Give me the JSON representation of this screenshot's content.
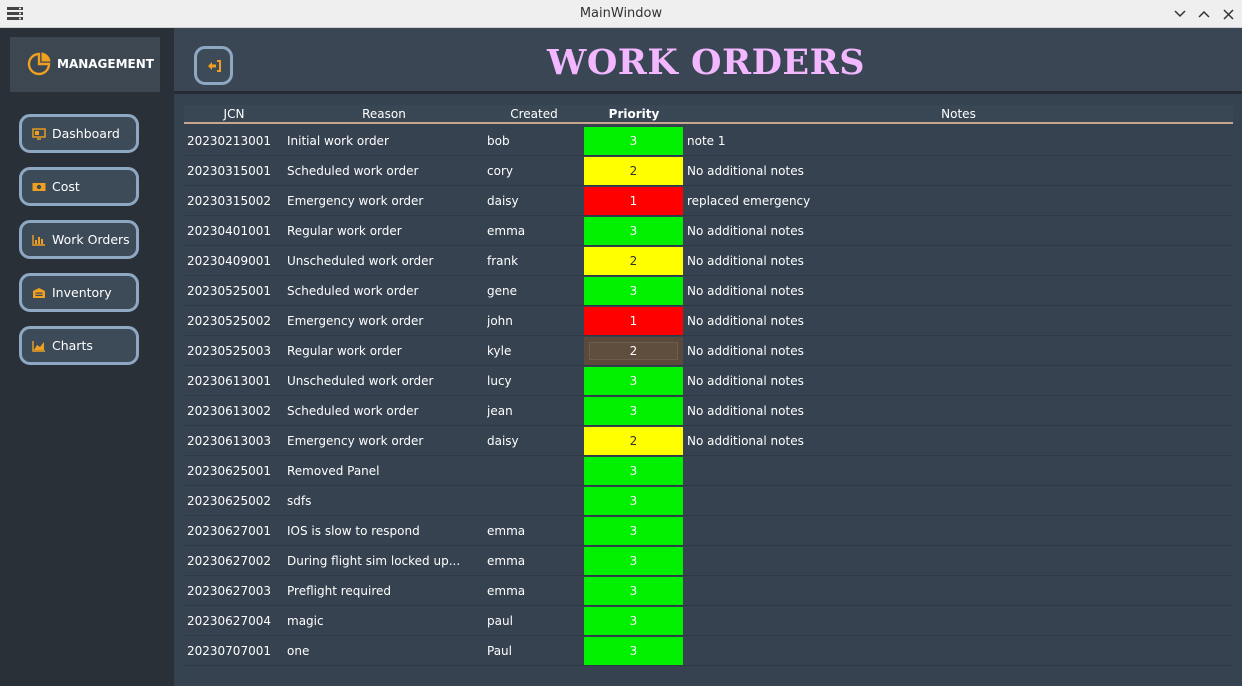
{
  "window": {
    "title": "MainWindow"
  },
  "sidebar": {
    "brand": "MANAGEMENT",
    "items": [
      {
        "label": "Dashboard",
        "icon": "monitor-icon"
      },
      {
        "label": "Cost",
        "icon": "cash-icon"
      },
      {
        "label": "Work Orders",
        "icon": "bar-chart-icon"
      },
      {
        "label": "Inventory",
        "icon": "warehouse-icon"
      },
      {
        "label": "Charts",
        "icon": "area-chart-icon"
      }
    ]
  },
  "header": {
    "title": "WORK ORDERS",
    "back_icon": "sign-out-arrow-icon"
  },
  "table": {
    "columns": [
      "JCN",
      "Reason",
      "Created",
      "Priority",
      "Notes"
    ],
    "rows": [
      {
        "jcn": "20230213001",
        "reason": "Initial work order",
        "created": "bob",
        "priority": "3",
        "notes": "note 1"
      },
      {
        "jcn": "20230315001",
        "reason": "Scheduled work order",
        "created": "cory",
        "priority": "2",
        "notes": "No additional notes"
      },
      {
        "jcn": "20230315002",
        "reason": "Emergency work order",
        "created": "daisy",
        "priority": "1",
        "notes": "replaced emergency"
      },
      {
        "jcn": "20230401001",
        "reason": "Regular work order",
        "created": "emma",
        "priority": "3",
        "notes": "No additional notes"
      },
      {
        "jcn": "20230409001",
        "reason": "Unscheduled work order",
        "created": "frank",
        "priority": "2",
        "notes": "No additional notes"
      },
      {
        "jcn": "20230525001",
        "reason": "Scheduled work order",
        "created": "gene",
        "priority": "3",
        "notes": "No additional notes"
      },
      {
        "jcn": "20230525002",
        "reason": "Emergency work order",
        "created": "john",
        "priority": "1",
        "notes": "No additional notes"
      },
      {
        "jcn": "20230525003",
        "reason": "Regular work order",
        "created": "kyle",
        "priority": "2",
        "notes": "No additional notes",
        "selected": true
      },
      {
        "jcn": "20230613001",
        "reason": "Unscheduled work order",
        "created": "lucy",
        "priority": "3",
        "notes": "No additional notes"
      },
      {
        "jcn": "20230613002",
        "reason": "Scheduled work order",
        "created": "jean",
        "priority": "3",
        "notes": "No additional notes"
      },
      {
        "jcn": "20230613003",
        "reason": "Emergency work order",
        "created": "daisy",
        "priority": "2",
        "notes": "No additional notes"
      },
      {
        "jcn": "20230625001",
        "reason": "Removed Panel",
        "created": "",
        "priority": "3",
        "notes": ""
      },
      {
        "jcn": "20230625002",
        "reason": "sdfs",
        "created": "",
        "priority": "3",
        "notes": ""
      },
      {
        "jcn": "20230627001",
        "reason": "IOS is slow to respond",
        "created": "emma",
        "priority": "3",
        "notes": ""
      },
      {
        "jcn": "20230627002",
        "reason": "During flight sim locked up...",
        "created": "emma",
        "priority": "3",
        "notes": ""
      },
      {
        "jcn": "20230627003",
        "reason": "Preflight required",
        "created": "emma",
        "priority": "3",
        "notes": ""
      },
      {
        "jcn": "20230627004",
        "reason": "magic",
        "created": "paul",
        "priority": "3",
        "notes": ""
      },
      {
        "jcn": "20230707001",
        "reason": "one",
        "created": "Paul",
        "priority": "3",
        "notes": ""
      }
    ]
  },
  "colors": {
    "priority_1": "#ff0000",
    "priority_2": "#ffff00",
    "priority_3": "#00f000",
    "title": "#f2b7ff",
    "accent_icon": "#f0a020",
    "button_border": "#8ea7c2"
  }
}
